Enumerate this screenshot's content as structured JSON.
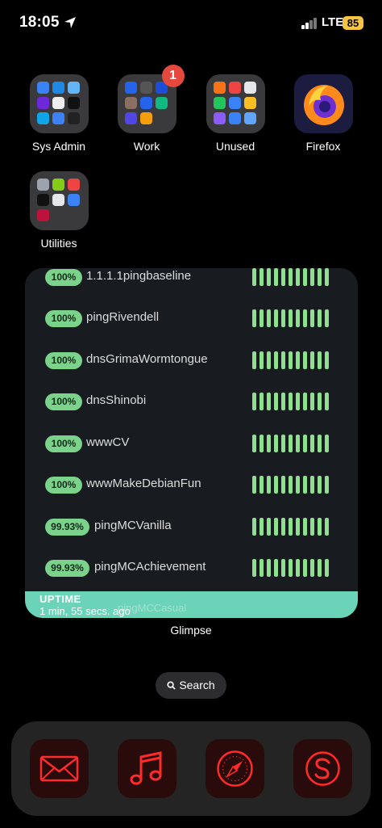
{
  "status_bar": {
    "time": "18:05",
    "network": "LTE",
    "battery": "85"
  },
  "home": {
    "apps": [
      {
        "label": "Sys Admin"
      },
      {
        "label": "Work",
        "badge": "1"
      },
      {
        "label": "Unused"
      },
      {
        "label": "Firefox"
      },
      {
        "label": "Utilities"
      }
    ]
  },
  "widget": {
    "name": "Glimpse",
    "rows": [
      {
        "percent": "100%",
        "name": "1.1.1.1pingbaseline"
      },
      {
        "percent": "100%",
        "name": "pingRivendell"
      },
      {
        "percent": "100%",
        "name": "dnsGrimaWormtongue"
      },
      {
        "percent": "100%",
        "name": "dnsShinobi"
      },
      {
        "percent": "100%",
        "name": "wwwCV"
      },
      {
        "percent": "100%",
        "name": "wwwMakeDebianFun"
      },
      {
        "percent": "99.93%",
        "name": "pingMCVanilla"
      },
      {
        "percent": "99.93%",
        "name": "pingMCAchievement"
      }
    ],
    "footer_title": "UPTIME",
    "footer_subtitle": "1 min, 55 secs. ago",
    "footer_partial": "pingMCCasual"
  },
  "search": {
    "label": "Search"
  },
  "dock": {
    "apps": [
      "mail",
      "music",
      "safari",
      "skype"
    ]
  },
  "colors": {
    "accent_green": "#7bd38b",
    "bar_green": "#8ee08f",
    "uptime_band": "#6bd3b7",
    "dock_red": "#ff2a2a"
  }
}
